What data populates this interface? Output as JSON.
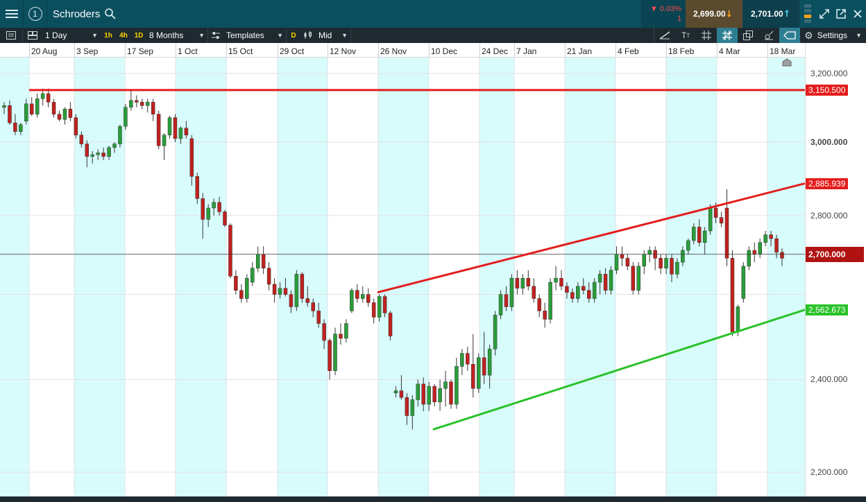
{
  "topbar": {
    "window_number": "1",
    "instrument": "Schroders",
    "change_pct": "▼ 0.03%",
    "change_sub": "1",
    "sell_price": "2,699.00",
    "buy_price": "2,701.00"
  },
  "toolbar": {
    "interval": "1 Day",
    "quick_intervals": [
      "1h",
      "4h",
      "1D"
    ],
    "range": "8 Months",
    "templates_label": "Templates",
    "d_label": "D",
    "price_type": "Mid",
    "settings_label": "Settings"
  },
  "colors": {
    "up_candle": "#2a9d3a",
    "down_candle": "#c0221f",
    "resistance": "#e31d1d",
    "support": "#28c228",
    "band": "#d8fbfb"
  },
  "chart_data": {
    "type": "candlestick",
    "instrument": "Schroders",
    "x_labels": [
      "20 Aug",
      "3 Sep",
      "17 Sep",
      "1 Oct",
      "15 Oct",
      "29 Oct",
      "12 Nov",
      "26 Nov",
      "10 Dec",
      "24 Dec",
      "7 Jan",
      "21 Jan",
      "4 Feb",
      "18 Feb",
      "4 Mar",
      "18 Mar"
    ],
    "y_ticks": [
      "3,200.000",
      "3,000.000",
      "2,800.000",
      "2,400.000",
      "2,200.000"
    ],
    "ylim": [
      2200,
      3200
    ],
    "current_price": "2,700.000",
    "lines": [
      {
        "name": "resistance",
        "color": "#e31d1d",
        "label": "3,150.500",
        "from": [
          "20 Aug",
          3150.5
        ],
        "to": [
          "end",
          3150.5
        ]
      },
      {
        "name": "upper-channel",
        "color": "#e31d1d",
        "label": "2,885.939",
        "from": [
          "26 Nov",
          2605
        ],
        "to": [
          "end",
          2885.9
        ]
      },
      {
        "name": "lower-channel",
        "color": "#28c228",
        "label": "2,562.673",
        "from": [
          "10 Dec",
          2290
        ],
        "to": [
          "end",
          2562.7
        ]
      }
    ],
    "candles": [
      [
        3100,
        3115,
        3080,
        3105
      ],
      [
        3105,
        3120,
        3050,
        3055
      ],
      [
        3055,
        3080,
        3020,
        3030
      ],
      [
        3030,
        3055,
        3020,
        3050
      ],
      [
        3060,
        3125,
        3050,
        3110
      ],
      [
        3110,
        3130,
        3075,
        3080
      ],
      [
        3080,
        3140,
        3070,
        3125
      ],
      [
        3125,
        3155,
        3105,
        3140
      ],
      [
        3140,
        3155,
        3100,
        3115
      ],
      [
        3115,
        3125,
        3070,
        3080
      ],
      [
        3080,
        3090,
        3060,
        3065
      ],
      [
        3065,
        3100,
        3050,
        3095
      ],
      [
        3095,
        3115,
        3060,
        3070
      ],
      [
        3070,
        3080,
        3010,
        3020
      ],
      [
        3020,
        3030,
        2985,
        2995
      ],
      [
        2995,
        3005,
        2930,
        2960
      ],
      [
        2960,
        2975,
        2940,
        2965
      ],
      [
        2965,
        2980,
        2950,
        2970
      ],
      [
        2970,
        2985,
        2950,
        2960
      ],
      [
        2960,
        2990,
        2950,
        2985
      ],
      [
        2985,
        3000,
        2970,
        2995
      ],
      [
        2995,
        3050,
        2985,
        3045
      ],
      [
        3045,
        3110,
        3035,
        3100
      ],
      [
        3100,
        3150,
        3090,
        3120
      ],
      [
        3120,
        3135,
        3100,
        3115
      ],
      [
        3115,
        3125,
        3095,
        3105
      ],
      [
        3105,
        3125,
        3085,
        3115
      ],
      [
        3115,
        3125,
        3060,
        3080
      ],
      [
        3080,
        3090,
        2980,
        2990
      ],
      [
        2990,
        3025,
        2950,
        3020
      ],
      [
        3020,
        3075,
        3010,
        3070
      ],
      [
        3070,
        3080,
        3000,
        3010
      ],
      [
        3010,
        3045,
        2995,
        3040
      ],
      [
        3040,
        3060,
        3010,
        3020
      ],
      [
        3010,
        3020,
        2880,
        2905
      ],
      [
        2905,
        2915,
        2830,
        2845
      ],
      [
        2845,
        2860,
        2740,
        2790
      ],
      [
        2790,
        2830,
        2770,
        2820
      ],
      [
        2820,
        2845,
        2800,
        2835
      ],
      [
        2835,
        2850,
        2800,
        2810
      ],
      [
        2810,
        2815,
        2770,
        2775
      ],
      [
        2775,
        2780,
        2640,
        2645
      ],
      [
        2645,
        2660,
        2600,
        2610
      ],
      [
        2610,
        2625,
        2580,
        2590
      ],
      [
        2590,
        2650,
        2580,
        2640
      ],
      [
        2630,
        2680,
        2620,
        2665
      ],
      [
        2665,
        2720,
        2655,
        2700
      ],
      [
        2700,
        2720,
        2650,
        2665
      ],
      [
        2665,
        2680,
        2610,
        2625
      ],
      [
        2625,
        2640,
        2580,
        2600
      ],
      [
        2600,
        2630,
        2590,
        2615
      ],
      [
        2615,
        2640,
        2595,
        2600
      ],
      [
        2600,
        2610,
        2555,
        2570
      ],
      [
        2570,
        2660,
        2560,
        2650
      ],
      [
        2650,
        2655,
        2580,
        2590
      ],
      [
        2590,
        2620,
        2570,
        2580
      ],
      [
        2580,
        2590,
        2545,
        2560
      ],
      [
        2560,
        2580,
        2520,
        2530
      ],
      [
        2530,
        2540,
        2470,
        2490
      ],
      [
        2490,
        2495,
        2400,
        2420
      ],
      [
        2420,
        2520,
        2410,
        2505
      ],
      [
        2505,
        2530,
        2480,
        2495
      ],
      [
        2495,
        2540,
        2485,
        2530
      ],
      [
        2560,
        2615,
        2555,
        2610
      ],
      [
        2610,
        2625,
        2580,
        2590
      ],
      [
        2590,
        2620,
        2580,
        2600
      ],
      [
        2600,
        2615,
        2570,
        2580
      ],
      [
        2580,
        2590,
        2530,
        2545
      ],
      [
        2545,
        2600,
        2535,
        2595
      ],
      [
        2595,
        2600,
        2545,
        2555
      ],
      [
        2555,
        2560,
        2490,
        2500
      ],
      [
        2370,
        2385,
        2360,
        2375
      ],
      [
        2375,
        2410,
        2355,
        2360
      ],
      [
        2360,
        2370,
        2300,
        2320
      ],
      [
        2320,
        2365,
        2290,
        2355
      ],
      [
        2355,
        2400,
        2340,
        2390
      ],
      [
        2390,
        2405,
        2330,
        2345
      ],
      [
        2345,
        2395,
        2330,
        2385
      ],
      [
        2385,
        2390,
        2340,
        2350
      ],
      [
        2350,
        2400,
        2330,
        2380
      ],
      [
        2380,
        2420,
        2340,
        2395
      ],
      [
        2395,
        2400,
        2335,
        2345
      ],
      [
        2345,
        2450,
        2335,
        2430
      ],
      [
        2430,
        2470,
        2410,
        2460
      ],
      [
        2460,
        2475,
        2420,
        2435
      ],
      [
        2435,
        2505,
        2360,
        2380
      ],
      [
        2380,
        2460,
        2370,
        2450
      ],
      [
        2450,
        2510,
        2390,
        2410
      ],
      [
        2410,
        2480,
        2380,
        2470
      ],
      [
        2470,
        2560,
        2455,
        2550
      ],
      [
        2550,
        2610,
        2540,
        2600
      ],
      [
        2600,
        2620,
        2560,
        2570
      ],
      [
        2570,
        2650,
        2560,
        2640
      ],
      [
        2640,
        2660,
        2600,
        2615
      ],
      [
        2615,
        2650,
        2600,
        2640
      ],
      [
        2640,
        2660,
        2610,
        2620
      ],
      [
        2620,
        2640,
        2580,
        2590
      ],
      [
        2590,
        2600,
        2545,
        2560
      ],
      [
        2560,
        2580,
        2520,
        2540
      ],
      [
        2540,
        2640,
        2530,
        2630
      ],
      [
        2630,
        2670,
        2610,
        2640
      ],
      [
        2640,
        2660,
        2610,
        2620
      ],
      [
        2620,
        2630,
        2590,
        2605
      ],
      [
        2605,
        2615,
        2580,
        2590
      ],
      [
        2590,
        2630,
        2580,
        2620
      ],
      [
        2620,
        2640,
        2600,
        2610
      ],
      [
        2610,
        2630,
        2580,
        2590
      ],
      [
        2590,
        2640,
        2580,
        2630
      ],
      [
        2630,
        2660,
        2600,
        2650
      ],
      [
        2650,
        2665,
        2600,
        2610
      ],
      [
        2610,
        2670,
        2600,
        2660
      ],
      [
        2660,
        2720,
        2650,
        2700
      ],
      [
        2700,
        2720,
        2670,
        2690
      ],
      [
        2690,
        2700,
        2660,
        2670
      ],
      [
        2670,
        2680,
        2600,
        2610
      ],
      [
        2610,
        2680,
        2600,
        2670
      ],
      [
        2670,
        2710,
        2650,
        2700
      ],
      [
        2700,
        2720,
        2680,
        2710
      ],
      [
        2710,
        2720,
        2660,
        2690
      ],
      [
        2690,
        2700,
        2650,
        2665
      ],
      [
        2665,
        2700,
        2650,
        2690
      ],
      [
        2690,
        2700,
        2630,
        2650
      ],
      [
        2650,
        2690,
        2640,
        2680
      ],
      [
        2680,
        2720,
        2670,
        2710
      ],
      [
        2710,
        2740,
        2700,
        2735
      ],
      [
        2735,
        2780,
        2725,
        2770
      ],
      [
        2770,
        2790,
        2720,
        2730
      ],
      [
        2730,
        2770,
        2700,
        2760
      ],
      [
        2760,
        2830,
        2750,
        2820
      ],
      [
        2820,
        2835,
        2780,
        2795
      ],
      [
        2795,
        2810,
        2770,
        2780
      ],
      [
        2820,
        2870,
        2670,
        2690
      ],
      [
        2690,
        2710,
        2500,
        2510
      ],
      [
        2510,
        2575,
        2500,
        2570
      ],
      [
        2590,
        2680,
        2580,
        2670
      ],
      [
        2670,
        2720,
        2660,
        2710
      ],
      [
        2710,
        2730,
        2680,
        2700
      ],
      [
        2700,
        2740,
        2690,
        2730
      ],
      [
        2730,
        2760,
        2720,
        2750
      ],
      [
        2750,
        2760,
        2720,
        2740
      ],
      [
        2740,
        2750,
        2690,
        2705
      ],
      [
        2705,
        2715,
        2670,
        2690
      ]
    ]
  }
}
